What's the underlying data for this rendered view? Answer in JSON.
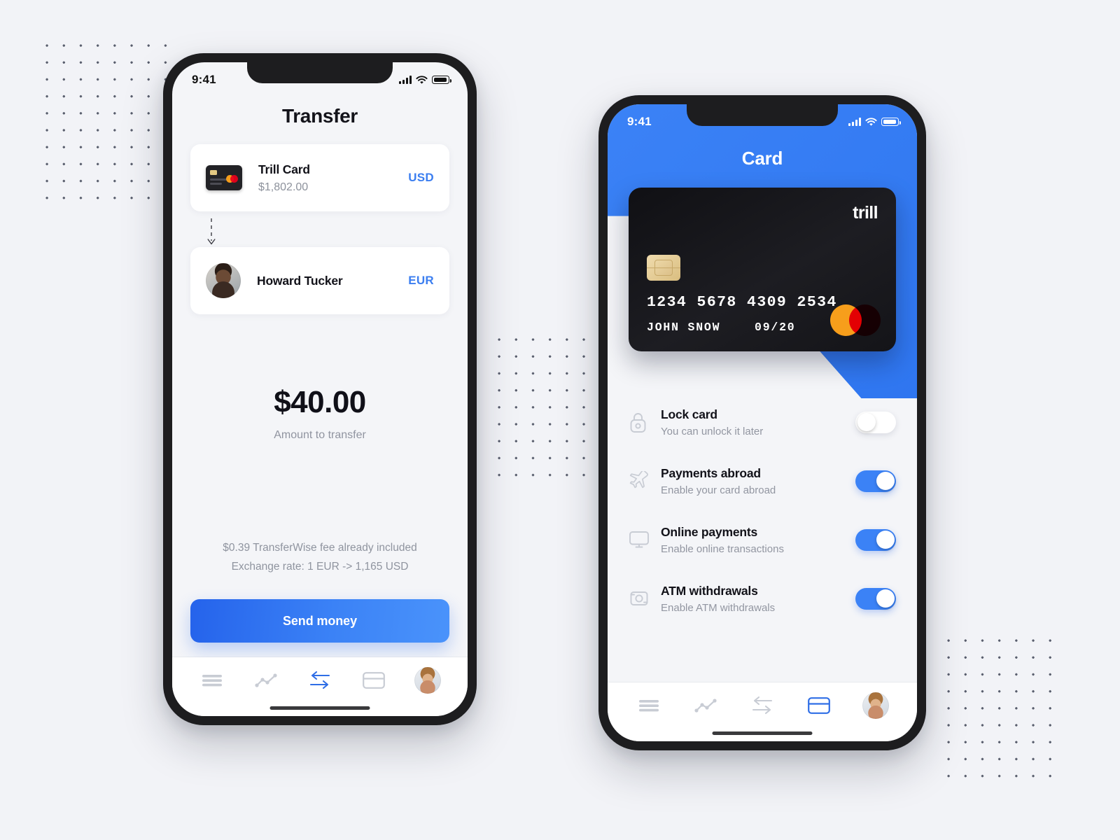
{
  "background": {
    "color": "#f2f3f7",
    "dot_color": "#3d4354",
    "dot_groups": [
      "top-left",
      "center",
      "bottom-right"
    ]
  },
  "theme": {
    "accent_blue": "#3b82f6",
    "accent_blue_dark": "#2563eb",
    "card_black": "#18181c",
    "text_primary": "#121219",
    "text_muted": "#9296a1"
  },
  "phone_left": {
    "status_bar": {
      "time": "9:41",
      "signal": "cellular-bars-icon",
      "wifi": "wifi-icon",
      "battery": "battery-icon"
    },
    "title": "Transfer",
    "source": {
      "name": "Trill Card",
      "balance": "$1,802.00",
      "currency": "USD",
      "thumbnail": "credit-card-thumbnail"
    },
    "connector_icon": "dashed-down-arrow-icon",
    "recipient": {
      "name": "Howard Tucker",
      "currency": "EUR",
      "avatar": "recipient-avatar"
    },
    "amount": {
      "value": "$40.00",
      "label": "Amount to transfer"
    },
    "notes": [
      "$0.39 TransferWise fee already included",
      "Exchange rate: 1 EUR -> 1,165 USD"
    ],
    "cta_label": "Send money",
    "tabs": [
      {
        "name": "menu",
        "icon": "hamburger-menu-icon",
        "active": false
      },
      {
        "name": "stats",
        "icon": "line-chart-icon",
        "active": false
      },
      {
        "name": "transfer",
        "icon": "transfer-arrows-icon",
        "active": true
      },
      {
        "name": "card",
        "icon": "credit-card-icon",
        "active": false
      },
      {
        "name": "profile",
        "icon": "profile-avatar-icon",
        "active": false
      }
    ]
  },
  "phone_right": {
    "status_bar": {
      "time": "9:41",
      "signal": "cellular-bars-icon",
      "wifi": "wifi-icon",
      "battery": "battery-icon"
    },
    "title": "Card",
    "card": {
      "brand": "trill",
      "number": "1234 5678 4309 2534",
      "holder": "JOHN SNOW",
      "expiry": "09/20",
      "network": "mastercard-logo",
      "chip": "emv-chip-icon"
    },
    "settings": [
      {
        "icon": "lock-icon",
        "title": "Lock card",
        "subtitle": "You can unlock it later",
        "enabled": false
      },
      {
        "icon": "airplane-icon",
        "title": "Payments abroad",
        "subtitle": "Enable your card abroad",
        "enabled": true
      },
      {
        "icon": "monitor-icon",
        "title": "Online payments",
        "subtitle": "Enable online transactions",
        "enabled": true
      },
      {
        "icon": "atm-icon",
        "title": "ATM withdrawals",
        "subtitle": "Enable ATM withdrawals",
        "enabled": true
      }
    ],
    "tabs": [
      {
        "name": "menu",
        "icon": "hamburger-menu-icon",
        "active": false
      },
      {
        "name": "stats",
        "icon": "line-chart-icon",
        "active": false
      },
      {
        "name": "transfer",
        "icon": "transfer-arrows-icon",
        "active": false
      },
      {
        "name": "card",
        "icon": "credit-card-icon",
        "active": true
      },
      {
        "name": "profile",
        "icon": "profile-avatar-icon",
        "active": false
      }
    ]
  }
}
